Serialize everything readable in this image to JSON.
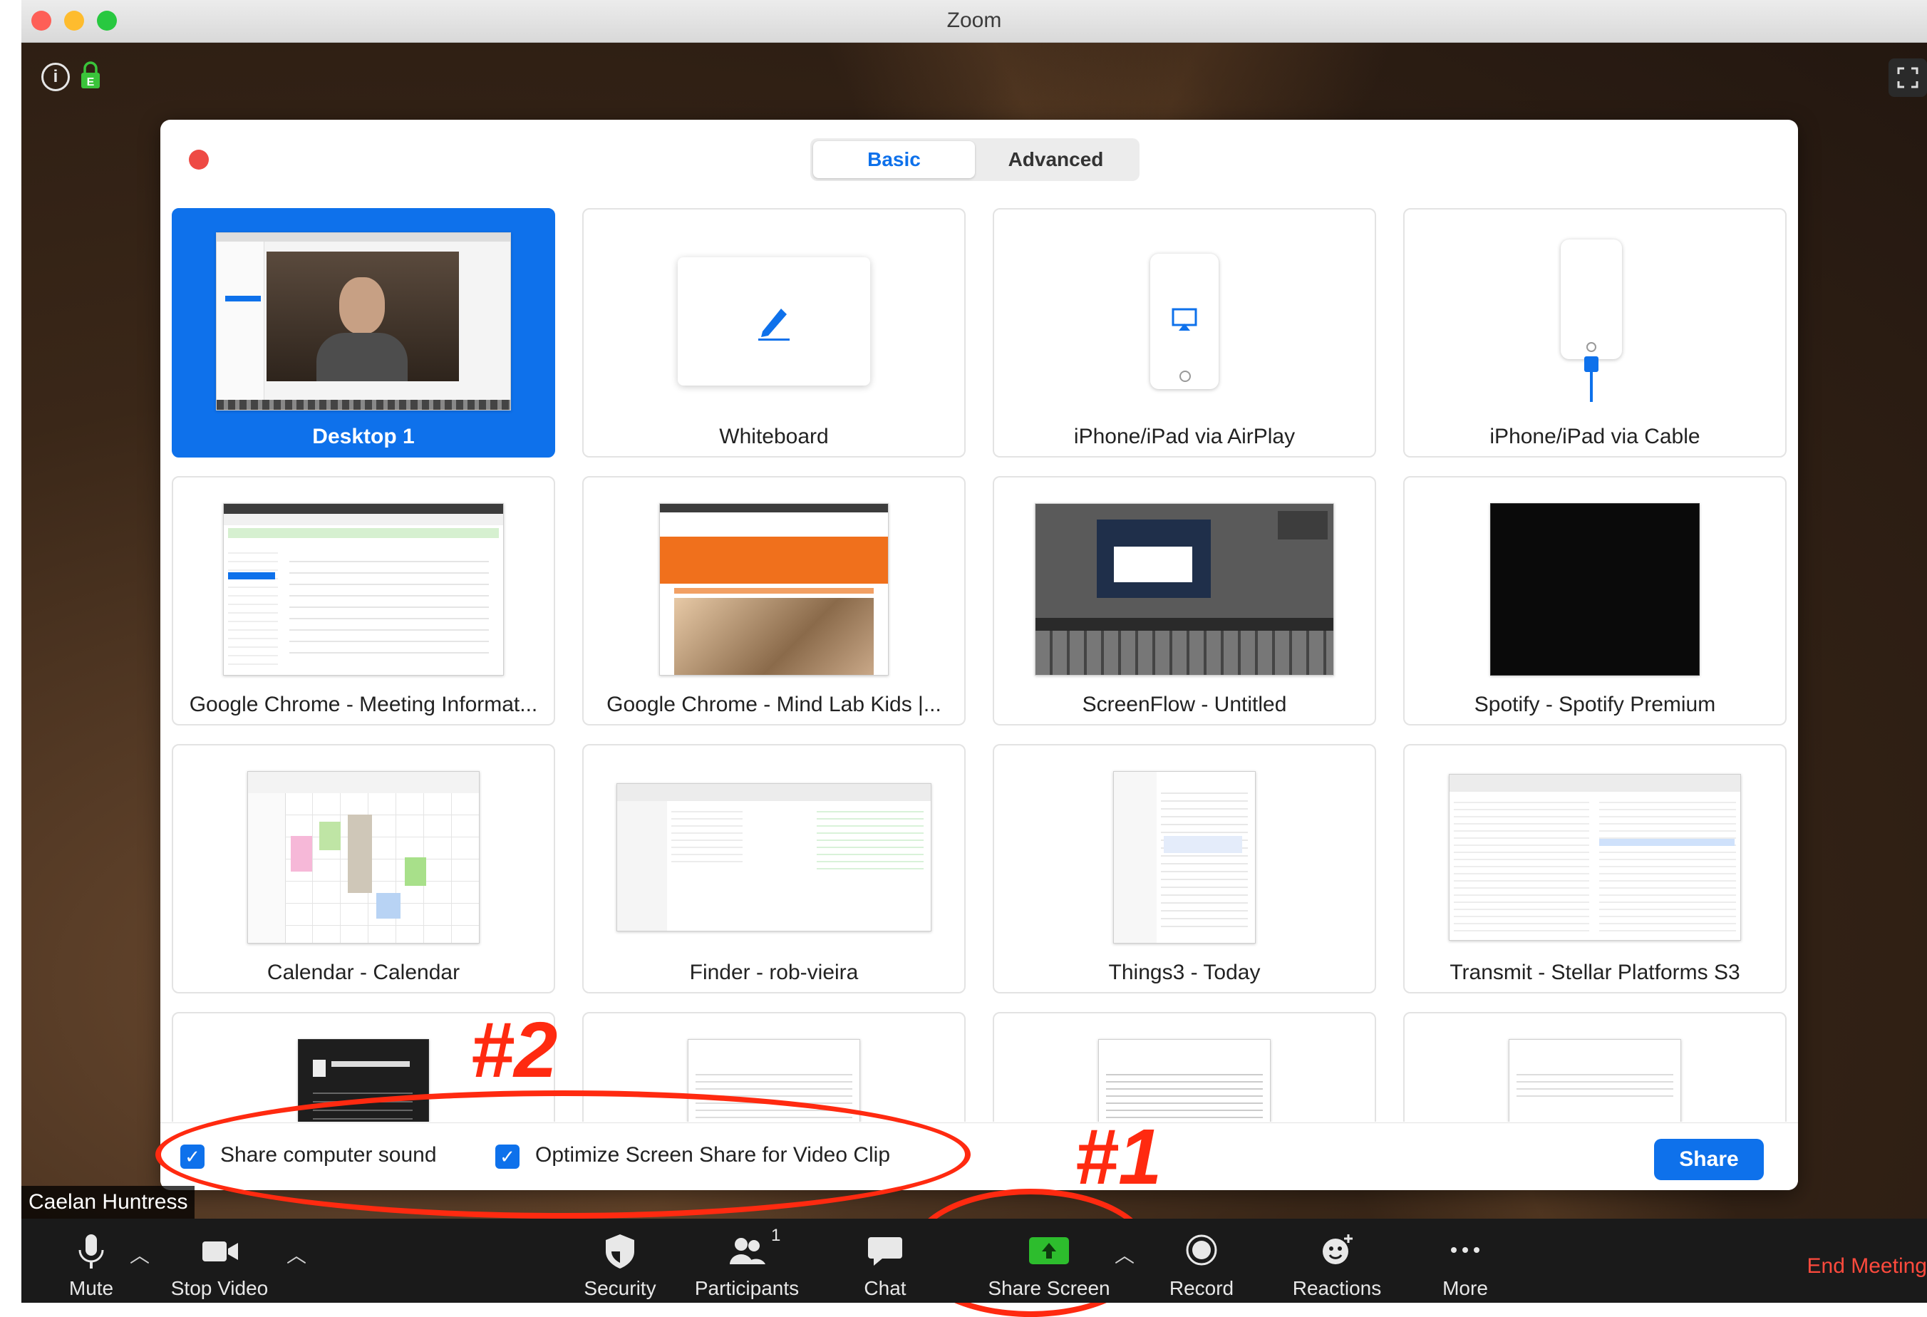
{
  "window": {
    "title": "Zoom"
  },
  "dialog": {
    "tabs": [
      {
        "label": "Basic",
        "active": true
      },
      {
        "label": "Advanced",
        "active": false
      }
    ],
    "tiles": [
      {
        "label": "Desktop 1",
        "selected": true,
        "thumb": "desktop"
      },
      {
        "label": "Whiteboard",
        "thumb": "whiteboard"
      },
      {
        "label": "iPhone/iPad via AirPlay",
        "thumb": "airplay"
      },
      {
        "label": "iPhone/iPad via Cable",
        "thumb": "cable"
      },
      {
        "label": "Google Chrome - Meeting Informat...",
        "thumb": "chrome-meeting"
      },
      {
        "label": "Google Chrome - Mind Lab Kids |...",
        "thumb": "chrome-mindlab"
      },
      {
        "label": "ScreenFlow - Untitled",
        "thumb": "screenflow"
      },
      {
        "label": "Spotify - Spotify Premium",
        "thumb": "spotify"
      },
      {
        "label": "Calendar - Calendar",
        "thumb": "calendar"
      },
      {
        "label": "Finder - rob-vieira",
        "thumb": "finder"
      },
      {
        "label": "Things3 - Today",
        "thumb": "things"
      },
      {
        "label": "Transmit - Stellar Platforms S3",
        "thumb": "transmit"
      },
      {
        "label": "",
        "thumb": "quicklook"
      },
      {
        "label": "",
        "thumb": "doc"
      },
      {
        "label": "",
        "thumb": "doc"
      },
      {
        "label": "",
        "thumb": "doc"
      }
    ],
    "footer": {
      "share_sound_label": "Share computer sound",
      "share_sound_checked": true,
      "optimize_label": "Optimize Screen Share for Video Clip",
      "optimize_checked": true,
      "share_button": "Share"
    }
  },
  "annotations": {
    "one": "#1",
    "two": "#2",
    "color": "#ff2a10"
  },
  "participant_name": "Caelan Huntress",
  "toolbar": {
    "mute": "Mute",
    "stop_video": "Stop Video",
    "security": "Security",
    "participants": "Participants",
    "participants_count": "1",
    "chat": "Chat",
    "share_screen": "Share Screen",
    "record": "Record",
    "reactions": "Reactions",
    "more": "More",
    "end_meeting": "End Meeting"
  },
  "colors": {
    "accent": "#0e71eb",
    "share_green": "#2dbd2d",
    "end_red": "#ff4a3d"
  }
}
